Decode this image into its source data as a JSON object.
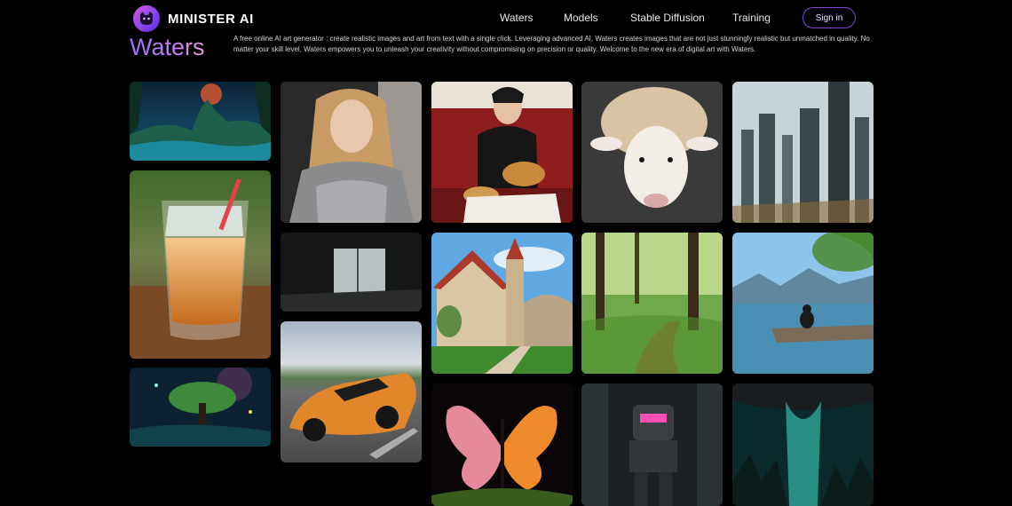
{
  "brand": {
    "name_primary": "MINISTER",
    "name_accent": "AI",
    "icon": "cat-logo-icon"
  },
  "nav": {
    "items": [
      {
        "label": "Waters"
      },
      {
        "label": "Models"
      },
      {
        "label": "Stable Diffusion"
      },
      {
        "label": "Training"
      }
    ],
    "signin_label": "Sign in"
  },
  "hero": {
    "title": "Waters",
    "description": "A free online AI art generator : create realistic images and art from text with a single click. Leveraging advanced AI, Waters creates images that are not just stunningly realistic but unmatched in quality. No matter your skill level, Waters empowers you to unleash your creativity without compromising on precision or quality. Welcome to the new era of digital art with Waters."
  },
  "colors": {
    "background": "#000000",
    "accent_purple": "#9d6cff",
    "accent_pink": "#e79ad8",
    "signin_border": "#7b47d8"
  },
  "gallery": {
    "items": [
      {
        "subject": "fantasy-night-castle"
      },
      {
        "subject": "iced-tea-glass"
      },
      {
        "subject": "glowing-forest-tree"
      },
      {
        "subject": "armored-girl"
      },
      {
        "subject": "empty-room"
      },
      {
        "subject": "orange-sports-car"
      },
      {
        "subject": "boy-with-cat"
      },
      {
        "subject": "european-village"
      },
      {
        "subject": "butterfly"
      },
      {
        "subject": "sheep"
      },
      {
        "subject": "forest-path"
      },
      {
        "subject": "mech-robot"
      },
      {
        "subject": "futuristic-city"
      },
      {
        "subject": "lake-with-cat"
      },
      {
        "subject": "glowing-cave"
      }
    ]
  }
}
